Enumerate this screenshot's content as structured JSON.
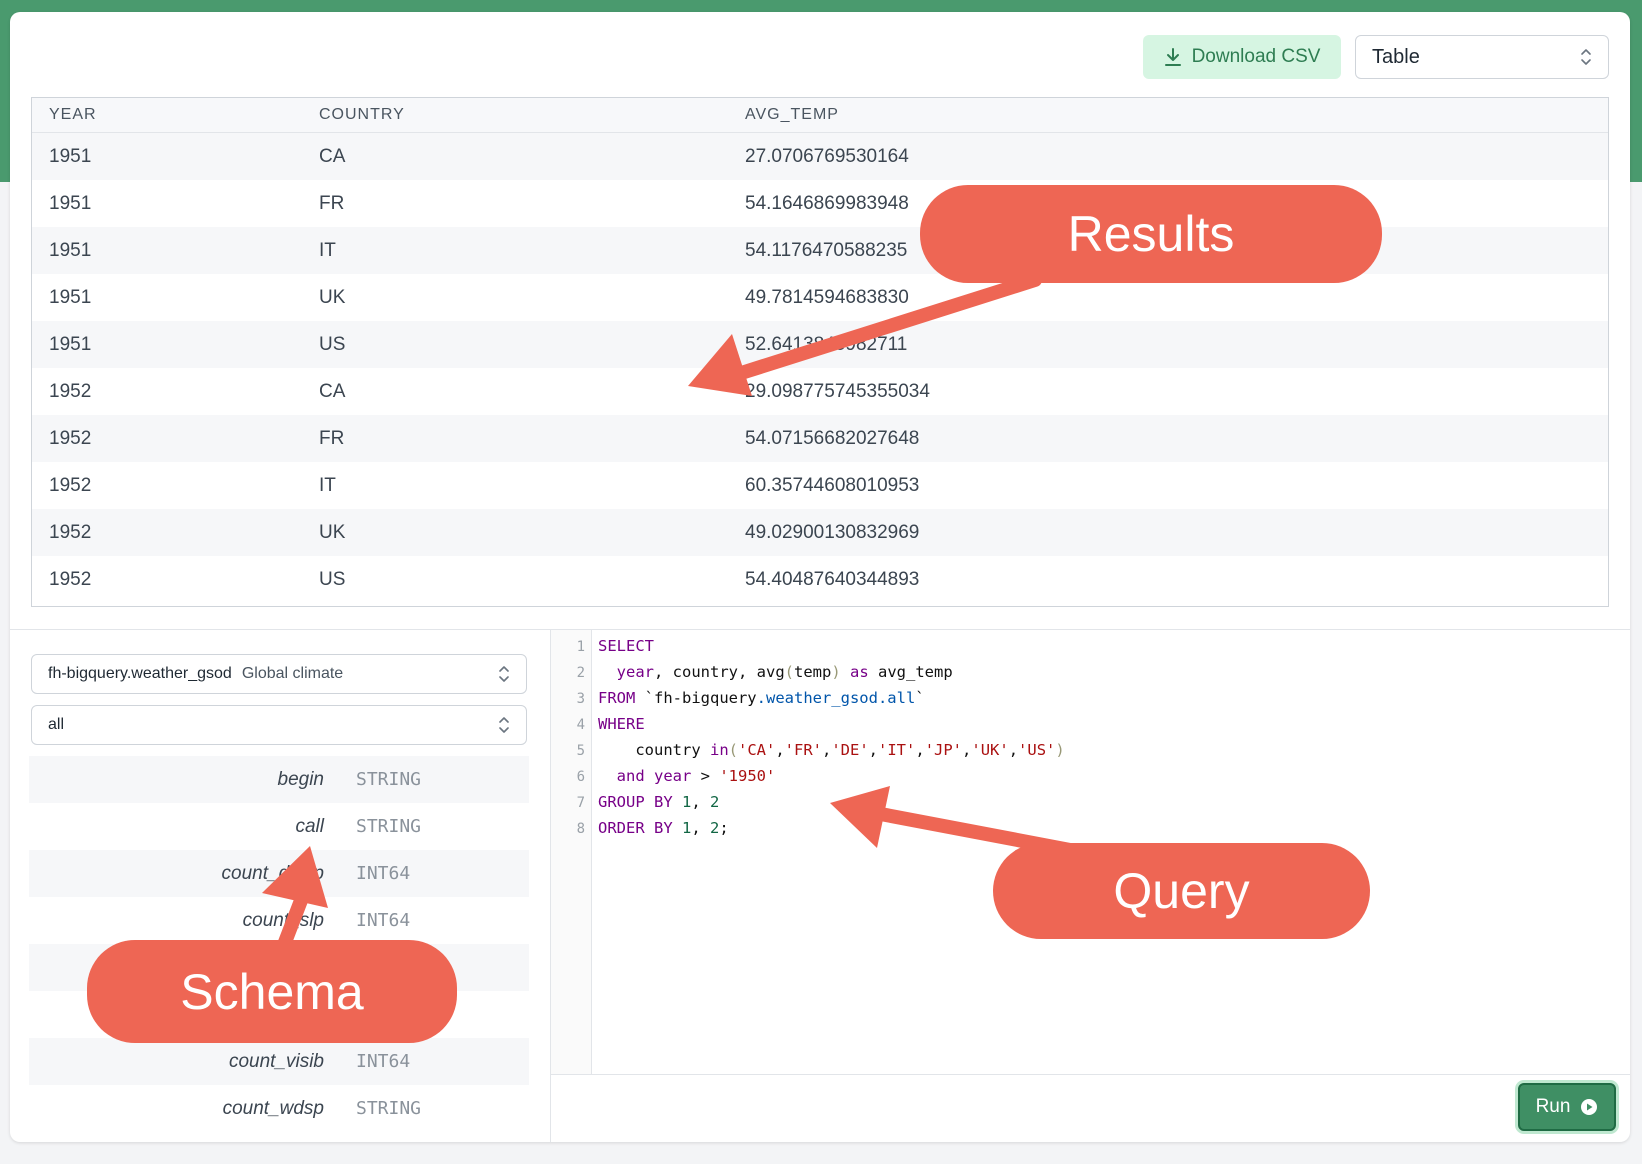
{
  "toolbar": {
    "download_label": "Download CSV",
    "view_mode": "Table"
  },
  "results": {
    "columns": [
      "YEAR",
      "COUNTRY",
      "AVG_TEMP"
    ],
    "rows": [
      [
        "1951",
        "CA",
        "27.0706769530164"
      ],
      [
        "1951",
        "FR",
        "54.1646869983948"
      ],
      [
        "1951",
        "IT",
        "54.1176470588235"
      ],
      [
        "1951",
        "UK",
        "49.7814594683830"
      ],
      [
        "1951",
        "US",
        "52.6413845982711"
      ],
      [
        "1952",
        "CA",
        "29.098775745355034"
      ],
      [
        "1952",
        "FR",
        "54.07156682027648"
      ],
      [
        "1952",
        "IT",
        "60.35744608010953"
      ],
      [
        "1952",
        "UK",
        "49.02900130832969"
      ],
      [
        "1952",
        "US",
        "54.40487640344893"
      ]
    ]
  },
  "schema": {
    "dataset": "fh-bigquery.weather_gsod",
    "dataset_desc": "Global climate",
    "table": "all",
    "fields": [
      {
        "name": "begin",
        "type": "STRING"
      },
      {
        "name": "call",
        "type": "STRING"
      },
      {
        "name": "count_dewp",
        "type": "INT64"
      },
      {
        "name": "count_slp",
        "type": "INT64"
      },
      {
        "name": "",
        "type": ""
      },
      {
        "name": "",
        "type": ""
      },
      {
        "name": "count_visib",
        "type": "INT64"
      },
      {
        "name": "count_wdsp",
        "type": "STRING"
      }
    ]
  },
  "editor": {
    "line_numbers": [
      "1",
      "2",
      "3",
      "4",
      "5",
      "6",
      "7",
      "8"
    ]
  },
  "run_label": "Run",
  "annotations": {
    "results": "Results",
    "query": "Query",
    "schema": "Schema"
  },
  "colors": {
    "brand_green": "#4a9a6e",
    "callout": "#ee6654"
  }
}
